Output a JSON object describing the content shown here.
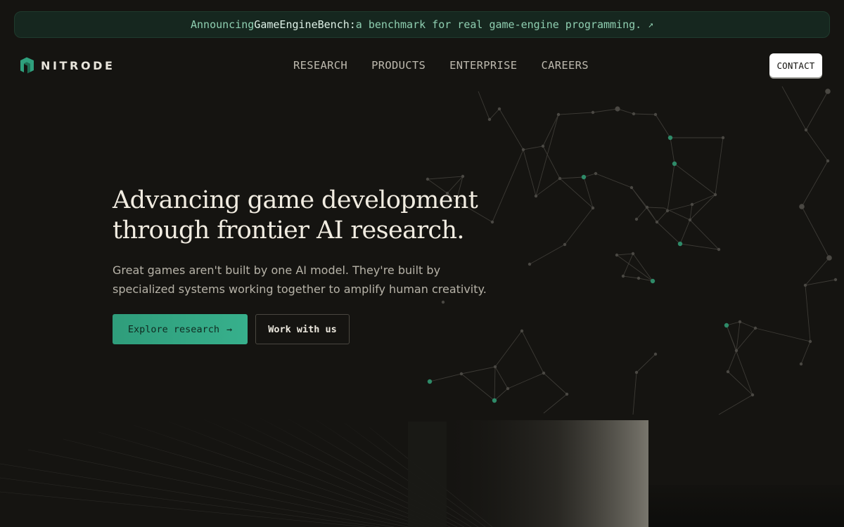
{
  "announcement": {
    "prefix": "Announcing ",
    "highlight": "GameEngineBench:",
    "suffix": " a benchmark for real game-engine programming.",
    "arrow_icon": "external-arrow-icon",
    "arrow_glyph": "↗"
  },
  "brand": {
    "name": "NITRODE",
    "logo_icon": "nitrode-logo-icon",
    "accent_color": "#2fa07d"
  },
  "nav": {
    "items": [
      {
        "label": "RESEARCH"
      },
      {
        "label": "PRODUCTS"
      },
      {
        "label": "ENTERPRISE"
      },
      {
        "label": "CAREERS"
      }
    ],
    "contact_label": "CONTACT"
  },
  "hero": {
    "title_line1": "Advancing game development",
    "title_line2": "through frontier AI research.",
    "subtitle_line1": "Great games aren't built by one AI model. They're built by",
    "subtitle_line2": "specialized systems working together to amplify human creativity.",
    "primary_label": "Explore research",
    "primary_arrow": "→",
    "secondary_label": "Work with us"
  },
  "colors": {
    "background": "#151411",
    "primary_button": "#33a886",
    "announcement_bg": "#16271f"
  }
}
